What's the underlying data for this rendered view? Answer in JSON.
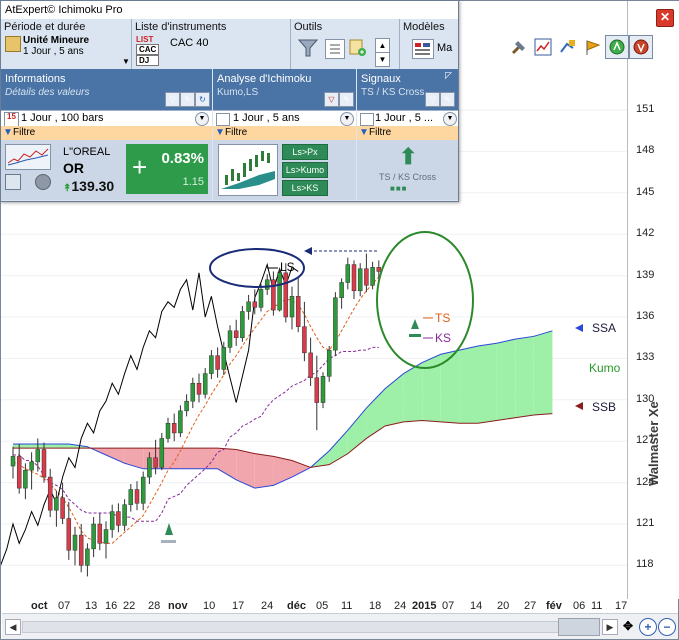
{
  "window": {
    "title": "AtExpert© Ichimoku Pro"
  },
  "toolbar": {
    "period_label": "Période et durée",
    "period_value": "Unité Mineure",
    "period_detail": "1 Jour , 5 ans",
    "instruments_label": "Liste d'instruments",
    "instrument_value": "CAC 40",
    "list_tags": [
      "LIST",
      "CAC",
      "DJ"
    ],
    "tools_label": "Outils",
    "models_label": "Modèles",
    "models_value": "Ma"
  },
  "panels": {
    "info": {
      "title": "Informations",
      "subtitle": "Détails des valeurs",
      "select": "1 Jour , 100 bars",
      "filter": "Filtre",
      "calendar_day": "15"
    },
    "ichimoku": {
      "title": "Analyse d'Ichimoku",
      "subtitle": "Kumo,LS",
      "select": "1 Jour , 5 ans",
      "filter": "Filtre",
      "buttons": [
        "Ls>Px",
        "Ls>Kumo",
        "Ls>KS"
      ]
    },
    "signals": {
      "title": "Signaux",
      "subtitle": "TS / KS Cross",
      "select": "1 Jour , 5 ...",
      "filter": "Filtre",
      "signal_label": "TS / KS Cross"
    }
  },
  "quote": {
    "name": "L\"OREAL",
    "ticker": "OR",
    "price": "139.30",
    "change_pct": "0.83%",
    "change": "1.15",
    "change_sign": "+"
  },
  "chart_data": {
    "type": "candlestick",
    "y_ticks": [
      "151",
      "148",
      "145",
      "142",
      "139",
      "136",
      "133",
      "130",
      "127",
      "124",
      "121",
      "118"
    ],
    "ylim": [
      115.5,
      152.5
    ],
    "x_ticks": [
      {
        "label": "oct",
        "bold": true
      },
      {
        "label": "07",
        "bold": false
      },
      {
        "label": "13",
        "bold": false
      },
      {
        "label": "16",
        "bold": false
      },
      {
        "label": "22",
        "bold": false
      },
      {
        "label": "28",
        "bold": false
      },
      {
        "label": "nov",
        "bold": true
      },
      {
        "label": "10",
        "bold": false
      },
      {
        "label": "17",
        "bold": false
      },
      {
        "label": "24",
        "bold": false
      },
      {
        "label": "déc",
        "bold": true
      },
      {
        "label": "05",
        "bold": false
      },
      {
        "label": "11",
        "bold": false
      },
      {
        "label": "18",
        "bold": false
      },
      {
        "label": "24",
        "bold": false
      },
      {
        "label": "2015",
        "bold": true
      },
      {
        "label": "07",
        "bold": false
      },
      {
        "label": "14",
        "bold": false
      },
      {
        "label": "20",
        "bold": false
      },
      {
        "label": "27",
        "bold": false
      },
      {
        "label": "fév",
        "bold": true
      },
      {
        "label": "06",
        "bold": false
      },
      {
        "label": "11",
        "bold": false
      },
      {
        "label": "17",
        "bold": false
      }
    ],
    "candles": [
      [
        125.2,
        126.6,
        124.3,
        125.9
      ],
      [
        125.9,
        126.8,
        123.2,
        123.6
      ],
      [
        123.6,
        125.4,
        122.8,
        124.9
      ],
      [
        124.9,
        126.2,
        123.5,
        125.5
      ],
      [
        125.5,
        127.2,
        124.8,
        126.4
      ],
      [
        126.4,
        126.9,
        124.0,
        124.4
      ],
      [
        124.4,
        125.0,
        121.5,
        122.0
      ],
      [
        122.0,
        123.4,
        120.8,
        122.9
      ],
      [
        122.9,
        124.0,
        121.0,
        121.4
      ],
      [
        121.4,
        122.6,
        118.4,
        119.1
      ],
      [
        119.1,
        120.8,
        118.0,
        120.2
      ],
      [
        120.2,
        121.0,
        117.5,
        118.0
      ],
      [
        118.0,
        119.6,
        117.2,
        119.2
      ],
      [
        119.2,
        121.5,
        118.6,
        121.0
      ],
      [
        121.0,
        121.8,
        119.1,
        119.6
      ],
      [
        119.6,
        121.2,
        118.5,
        120.6
      ],
      [
        120.6,
        122.4,
        120.0,
        121.9
      ],
      [
        121.9,
        122.5,
        120.4,
        120.9
      ],
      [
        120.9,
        122.8,
        120.5,
        122.4
      ],
      [
        122.4,
        123.9,
        121.9,
        123.5
      ],
      [
        123.5,
        124.1,
        122.0,
        122.5
      ],
      [
        122.5,
        124.8,
        122.0,
        124.4
      ],
      [
        124.4,
        126.2,
        123.9,
        125.8
      ],
      [
        125.8,
        127.1,
        124.6,
        125.1
      ],
      [
        125.1,
        127.6,
        124.9,
        127.2
      ],
      [
        127.2,
        128.7,
        126.9,
        128.3
      ],
      [
        128.3,
        129.0,
        127.0,
        127.6
      ],
      [
        127.6,
        129.6,
        127.3,
        129.2
      ],
      [
        129.2,
        130.4,
        128.8,
        129.9
      ],
      [
        129.9,
        131.6,
        129.4,
        131.2
      ],
      [
        131.2,
        131.9,
        129.8,
        130.4
      ],
      [
        130.4,
        132.3,
        130.1,
        131.9
      ],
      [
        131.9,
        133.6,
        131.5,
        133.2
      ],
      [
        133.2,
        133.8,
        131.6,
        132.2
      ],
      [
        132.2,
        134.2,
        131.8,
        133.8
      ],
      [
        133.8,
        135.4,
        133.4,
        135.0
      ],
      [
        135.0,
        135.8,
        133.9,
        134.5
      ],
      [
        134.5,
        136.8,
        134.2,
        136.4
      ],
      [
        136.4,
        137.6,
        135.8,
        137.1
      ],
      [
        137.1,
        138.0,
        136.2,
        136.7
      ],
      [
        136.7,
        138.4,
        136.4,
        138.0
      ],
      [
        138.0,
        139.1,
        137.6,
        138.7
      ],
      [
        138.7,
        139.3,
        136.1,
        136.5
      ],
      [
        136.5,
        139.5,
        136.4,
        139.2
      ],
      [
        139.2,
        139.9,
        135.6,
        136.0
      ],
      [
        136.0,
        138.2,
        135.1,
        137.5
      ],
      [
        137.5,
        138.9,
        134.9,
        135.3
      ],
      [
        135.3,
        137.1,
        132.8,
        133.4
      ],
      [
        133.4,
        134.5,
        131.0,
        131.6
      ],
      [
        131.6,
        133.2,
        127.8,
        129.8
      ],
      [
        129.8,
        132.0,
        129.4,
        131.7
      ],
      [
        131.7,
        133.9,
        131.3,
        133.6
      ],
      [
        133.6,
        137.8,
        133.2,
        137.4
      ],
      [
        137.4,
        138.8,
        136.6,
        138.5
      ],
      [
        138.5,
        140.3,
        138.0,
        139.8
      ],
      [
        139.8,
        140.1,
        137.3,
        137.9
      ],
      [
        137.9,
        139.9,
        137.5,
        139.5
      ],
      [
        139.5,
        140.6,
        137.8,
        138.3
      ],
      [
        138.3,
        140.0,
        138.0,
        139.6
      ],
      [
        139.6,
        140.1,
        138.5,
        139.3
      ]
    ],
    "kijun_sen": [
      126.0,
      126.0,
      125.6,
      125.6,
      125.2,
      124.5,
      124.0,
      123.8,
      123.5,
      122.8,
      122.4,
      122.0,
      121.8,
      121.8,
      121.8,
      121.8,
      121.8,
      121.5,
      121.5,
      121.5,
      121.2,
      121.2,
      121.2,
      121.2,
      121.8,
      122.8,
      123.0,
      123.2,
      123.8,
      124.2,
      124.6,
      125.0,
      125.5,
      126.2,
      126.4,
      127.3,
      127.6,
      128.1,
      128.3,
      128.6,
      128.8,
      129.5,
      130.0,
      130.3,
      130.6,
      131.0,
      131.2,
      131.4,
      131.8,
      132.0,
      132.5,
      133.0,
      133.2,
      133.5,
      133.5,
      133.5,
      133.6,
      133.6,
      133.8,
      133.8
    ],
    "tenkan_sen": [
      125.5,
      125.3,
      125.0,
      124.8,
      124.6,
      124.3,
      123.9,
      123.4,
      122.9,
      122.2,
      121.4,
      120.5,
      120.0,
      119.8,
      119.7,
      119.6,
      119.6,
      120.0,
      120.4,
      120.8,
      121.2,
      121.6,
      122.4,
      123.2,
      124.0,
      124.9,
      125.5,
      126.3,
      127.2,
      128.1,
      128.9,
      129.6,
      130.4,
      131.1,
      131.8,
      132.6,
      133.2,
      133.9,
      134.6,
      135.2,
      135.8,
      136.4,
      136.7,
      137.0,
      137.3,
      137.2,
      136.9,
      136.2,
      135.3,
      134.5,
      133.8,
      133.6,
      134.2,
      135.0,
      135.8,
      136.6,
      137.3,
      137.9,
      138.4,
      138.9
    ],
    "kumo_x": [
      0,
      3,
      6,
      9,
      12,
      15,
      18,
      21,
      24,
      27,
      30,
      33,
      36,
      39,
      42,
      45,
      48,
      51,
      54,
      57,
      60,
      63,
      66,
      69,
      72,
      75,
      78,
      81,
      84,
      87
    ],
    "senkou_a": [
      126.8,
      126.8,
      126.8,
      126.8,
      126.6,
      126.0,
      125.4,
      125.0,
      125.0,
      125.0,
      125.0,
      125.0,
      124.2,
      123.6,
      123.8,
      124.4,
      125.1,
      126.3,
      127.8,
      129.4,
      130.8,
      131.9,
      132.7,
      133.3,
      133.6,
      133.9,
      134.1,
      134.4,
      134.6,
      135.0
    ],
    "senkou_b": [
      126.5,
      126.5,
      126.5,
      126.5,
      126.5,
      126.5,
      126.5,
      126.5,
      126.5,
      126.5,
      126.5,
      126.5,
      126.4,
      126.1,
      125.9,
      125.6,
      125.1,
      125.3,
      126.1,
      127.2,
      128.1,
      128.4,
      128.5,
      128.4,
      128.3,
      128.3,
      128.5,
      128.7,
      128.9,
      129.0
    ],
    "chikou_x": [
      -26,
      -25,
      -24,
      -23,
      -22,
      -21,
      -20,
      -19,
      -18,
      -17,
      -16,
      -15,
      -14,
      -13,
      -12,
      -11,
      -10,
      -9,
      -8,
      -7,
      -6,
      -5,
      -4,
      -3,
      -2,
      -1,
      0,
      1,
      2,
      3,
      4,
      5,
      6,
      7,
      8,
      9,
      10,
      11,
      12,
      13,
      14,
      15,
      16,
      17,
      18,
      19,
      20,
      21,
      22,
      23,
      24,
      25,
      26,
      27,
      28,
      29,
      30,
      31,
      32,
      33
    ],
    "annotations": [
      "LS",
      "TS",
      "KS",
      "SSA",
      "SSB",
      "Kumo"
    ]
  },
  "watermark": "Walmaster Xe",
  "colors": {
    "up": "#2e9b3a",
    "down": "#d83b4a",
    "kumo_bull": "#9ef0a8",
    "kumo_bear": "#f1a5ad",
    "ssa": "#2b48d8",
    "ssb": "#8b1d1d",
    "ts": "#e0601a",
    "ks": "#8a2a9c",
    "ls": "#000000",
    "ellipse_blue": "#1a2b78",
    "ellipse_green": "#2a8a2a"
  }
}
